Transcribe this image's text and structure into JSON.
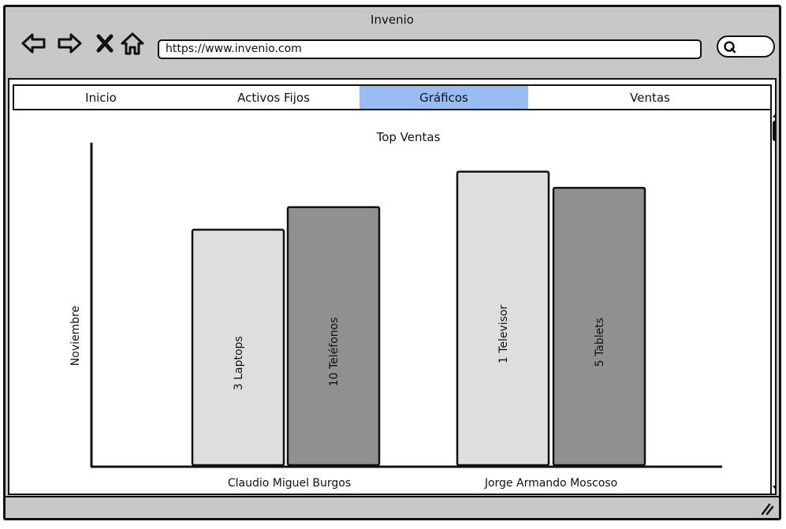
{
  "window": {
    "title": "Invenio"
  },
  "browser": {
    "url": "https://www.invenio.com"
  },
  "tabs": [
    {
      "label": "Inicio",
      "active": false
    },
    {
      "label": "Activos Fijos",
      "active": false
    },
    {
      "label": "Gráficos",
      "active": true
    },
    {
      "label": "Ventas",
      "active": false
    }
  ],
  "colors": {
    "active_tab": "#99bdf2",
    "bar_light": "#dedede",
    "bar_dark": "#909090",
    "chrome": "#c8c8c8"
  },
  "chart_data": {
    "type": "bar",
    "title": "Top Ventas",
    "ylabel": "Noviembre",
    "xlabel": "",
    "categories": [
      "Claudio Miguel Burgos",
      "Jorge Armando Moscoso"
    ],
    "bars": [
      {
        "category": "Claudio Miguel Burgos",
        "label": "3 Laptops",
        "value": 3,
        "shade": "light"
      },
      {
        "category": "Claudio Miguel Burgos",
        "label": "10 Teléfonos",
        "value": 10,
        "shade": "dark"
      },
      {
        "category": "Jorge Armando Moscoso",
        "label": "1 Televisor",
        "value": 1,
        "shade": "light"
      },
      {
        "category": "Jorge Armando Moscoso",
        "label": "5 Tablets",
        "value": 5,
        "shade": "dark"
      }
    ],
    "bar_levels": [
      0.73,
      0.8,
      0.91,
      0.86
    ],
    "grid": false,
    "legend": "none"
  }
}
